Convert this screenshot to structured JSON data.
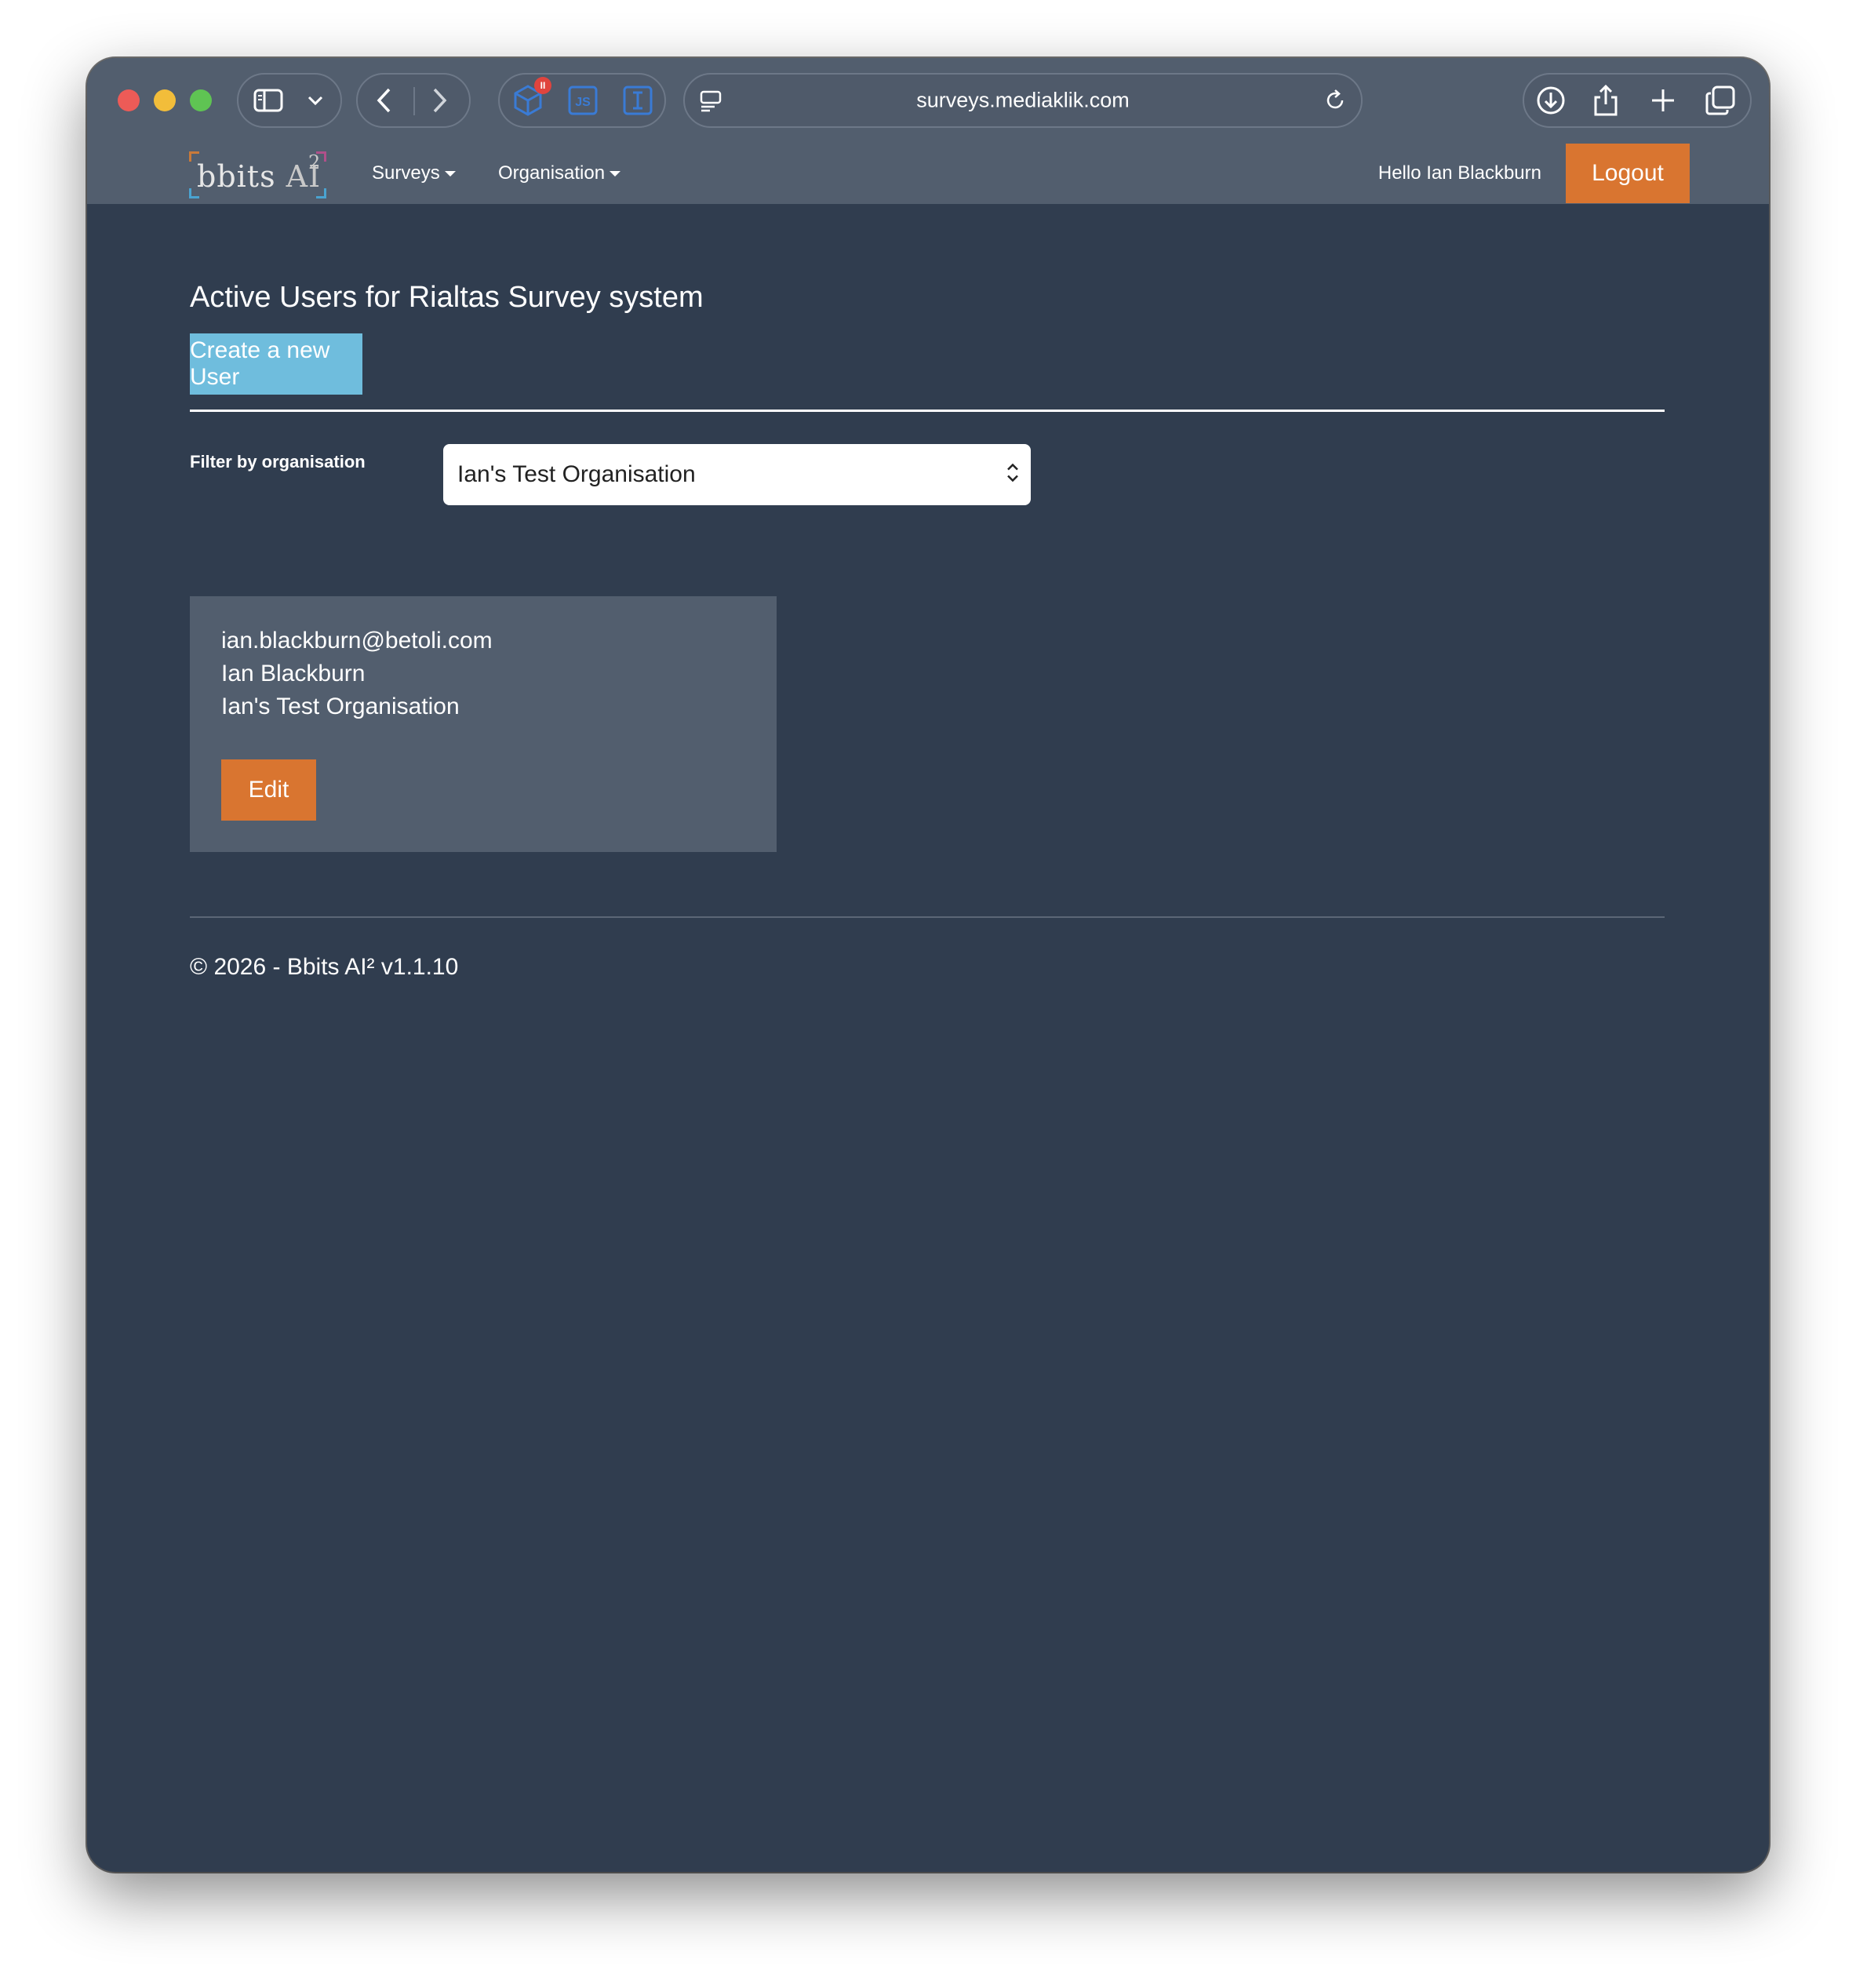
{
  "browser": {
    "url": "surveys.mediaklik.com",
    "extension_badge": "II",
    "extension_js_label": "JS",
    "extension_i_label": "I"
  },
  "navbar": {
    "brand": {
      "text_bold": "bbits",
      "text_light": "AI",
      "sup": "2"
    },
    "links": [
      {
        "label": "Surveys"
      },
      {
        "label": "Organisation"
      }
    ],
    "greeting": "Hello Ian Blackburn",
    "logout_label": "Logout"
  },
  "main": {
    "title": "Active Users for Rialtas Survey system",
    "create_button_label": "Create a new User",
    "filter": {
      "label": "Filter by organisation",
      "selected": "Ian's Test Organisation"
    },
    "users": [
      {
        "email": "ian.blackburn@betoli.com",
        "name": "Ian Blackburn",
        "organisation": "Ian's Test Organisation",
        "edit_label": "Edit"
      }
    ]
  },
  "footer": {
    "text": "© 2026 - Bbits AI² v1.1.10"
  },
  "colors": {
    "page_bg": "#303d4f",
    "bar_bg": "#525e6e",
    "accent_orange": "#d97530",
    "accent_blue": "#6fbddd"
  }
}
